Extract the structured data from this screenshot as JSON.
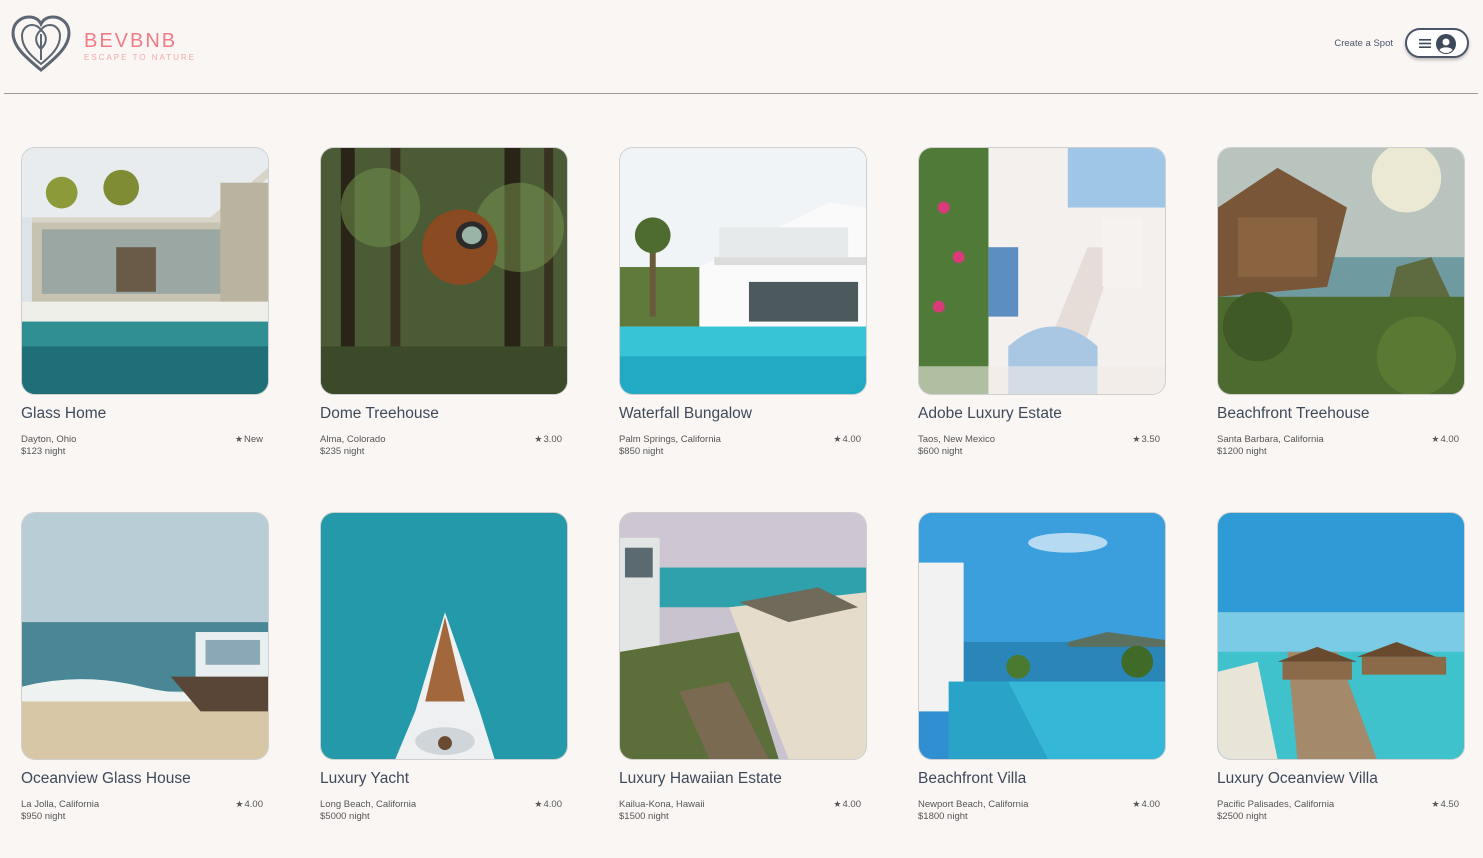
{
  "header": {
    "brand_name": "BEVBNB",
    "brand_tagline": "ESCAPE TO NATURE",
    "create_spot_label": "Create a Spot"
  },
  "icons": {
    "logo": "heart-leaf-logo",
    "menu": "hamburger-menu-icon",
    "user": "user-avatar-icon",
    "star": "star-icon"
  },
  "colors": {
    "brand": "#f07c84",
    "background": "#faf6f4",
    "text": "#3e4a5a"
  },
  "spots": [
    {
      "name": "Glass Home",
      "location": "Dayton, Ohio",
      "price": "$123 night",
      "rating": "New"
    },
    {
      "name": "Dome Treehouse",
      "location": "Alma, Colorado",
      "price": "$235 night",
      "rating": "3.00"
    },
    {
      "name": "Waterfall Bungalow",
      "location": "Palm Springs, California",
      "price": "$850 night",
      "rating": "4.00"
    },
    {
      "name": "Adobe Luxury Estate",
      "location": "Taos, New Mexico",
      "price": "$600 night",
      "rating": "3.50"
    },
    {
      "name": "Beachfront Treehouse",
      "location": "Santa Barbara, California",
      "price": "$1200 night",
      "rating": "4.00"
    },
    {
      "name": "Oceanview Glass House",
      "location": "La Jolla, California",
      "price": "$950 night",
      "rating": "4.00"
    },
    {
      "name": "Luxury Yacht",
      "location": "Long Beach, California",
      "price": "$5000 night",
      "rating": "4.00"
    },
    {
      "name": "Luxury Hawaiian Estate",
      "location": "Kailua-Kona, Hawaii",
      "price": "$1500 night",
      "rating": "4.00"
    },
    {
      "name": "Beachfront Villa",
      "location": "Newport Beach, California",
      "price": "$1800 night",
      "rating": "4.00"
    },
    {
      "name": "Luxury Oceanview Villa",
      "location": "Pacific Palisades, California",
      "price": "$2500 night",
      "rating": "4.50"
    }
  ]
}
